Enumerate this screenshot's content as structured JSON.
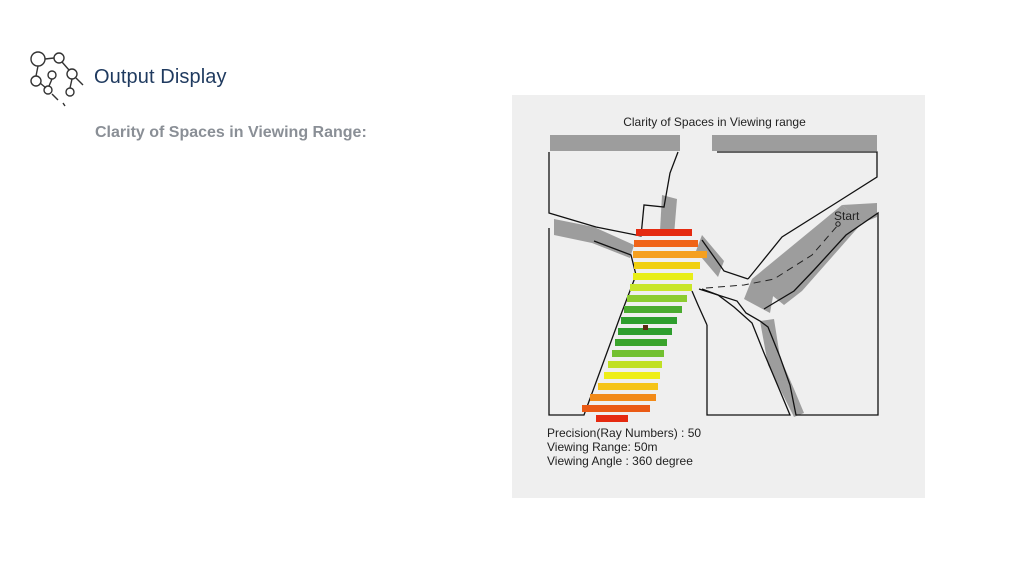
{
  "header": {
    "title": "Output Display",
    "logo_icon": "network-magnifier-icon"
  },
  "section": {
    "subtitle": "Clarity of Spaces in Viewing Range:"
  },
  "figure": {
    "title": "Clarity of Spaces in Viewing range",
    "start_label": "Start",
    "params": [
      "Precision(Ray Numbers) : 50",
      "Viewing Range: 50m",
      "Viewing Angle : 360 degree"
    ],
    "colors": {
      "background": "#efefef",
      "wall_shadow": "#8f8f8f",
      "clarity_high": "#2e9e2e",
      "clarity_mid": "#f2f20a",
      "clarity_low": "#e52a10"
    }
  }
}
